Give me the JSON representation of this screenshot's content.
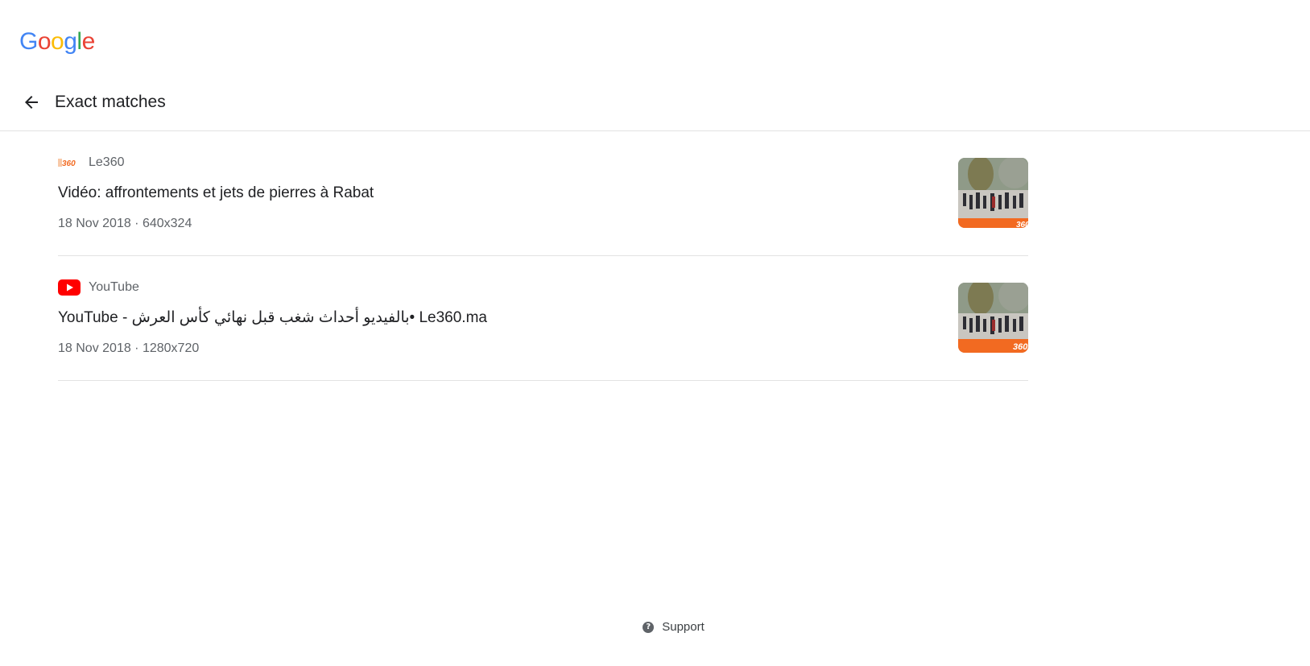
{
  "logo": {
    "letters": [
      {
        "ch": "G",
        "color": "#4285F4"
      },
      {
        "ch": "o",
        "color": "#EA4335"
      },
      {
        "ch": "o",
        "color": "#FBBC05"
      },
      {
        "ch": "g",
        "color": "#4285F4"
      },
      {
        "ch": "l",
        "color": "#34A853"
      },
      {
        "ch": "e",
        "color": "#EA4335"
      }
    ]
  },
  "header": {
    "back_icon": "arrow-back-icon",
    "title": "Exact matches"
  },
  "results": [
    {
      "source": "Le360",
      "favicon": "le360-favicon",
      "favicon_text": "le360",
      "title": "Vidéo: affrontements et jets de pierres à Rabat",
      "meta": "18 Nov 2018 · 640x324",
      "thumb_label": "360"
    },
    {
      "source": "YouTube",
      "favicon": "youtube-favicon",
      "title": "YouTube - بالفيديو أحداث شغب قبل نهائي كأس العرش• Le360.ma",
      "meta": "18 Nov 2018 · 1280x720",
      "thumb_label": "360"
    }
  ],
  "footer": {
    "support_icon": "help-icon",
    "support_label": "Support"
  },
  "colors": {
    "le360_orange": "#F26A21",
    "youtube_red": "#FF0000"
  }
}
